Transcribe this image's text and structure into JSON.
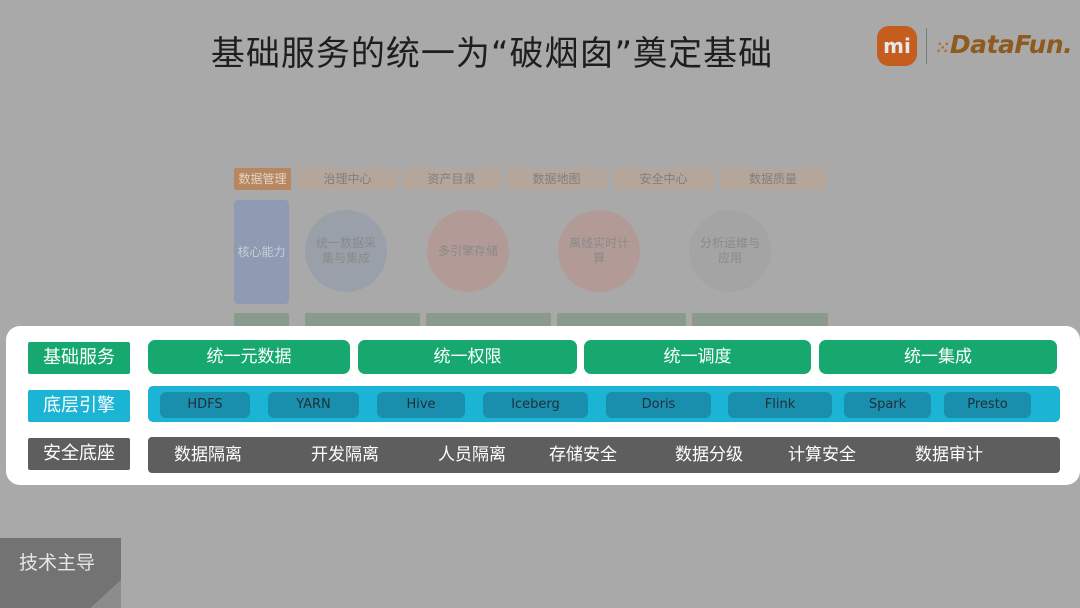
{
  "title": "基础服务的统一为“破烟囱”奠定基础",
  "logos": {
    "mi": "mi",
    "datafun": "DataFun."
  },
  "background_diagram": {
    "top_row": [
      "数据管理",
      "治理中心",
      "资产目录",
      "数据地图",
      "安全中心",
      "数据质量"
    ],
    "core_label": "核心能力",
    "circles": [
      "统一数据采集与集成",
      "多引擎存储",
      "离线实时计算",
      "分析运维与应用"
    ]
  },
  "panel": {
    "base_service": {
      "label": "基础服务",
      "items": [
        "统一元数据",
        "统一权限",
        "统一调度",
        "统一集成"
      ]
    },
    "engine": {
      "label": "底层引擎",
      "items": [
        "HDFS",
        "YARN",
        "Hive",
        "Iceberg",
        "Doris",
        "Flink",
        "Spark",
        "Presto"
      ]
    },
    "security": {
      "label": "安全底座",
      "items": [
        "数据隔离",
        "开发隔离",
        "人员隔离",
        "存储安全",
        "数据分级",
        "计算安全",
        "数据审计"
      ]
    }
  },
  "ribbon": "技术主导",
  "colors": {
    "green": "#17a870",
    "cyan": "#1bb4d4",
    "dark": "#5e5e5e",
    "overlay": "#a9a9a9"
  }
}
